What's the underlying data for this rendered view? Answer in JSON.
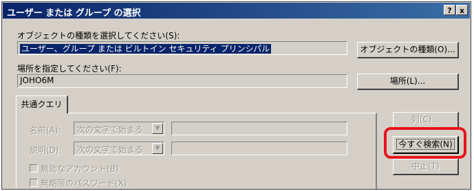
{
  "window": {
    "title": "ユーザー または グループ の選択",
    "help_btn": "?",
    "close_btn": "x"
  },
  "object_type": {
    "label": "オブジェクトの種類を選択してください(S):",
    "value": "ユーザー、グループ または ビルトイン セキュリティ プリンシパル",
    "button": "オブジェクトの種類(O)..."
  },
  "location": {
    "label": "場所を指定してください(F):",
    "value": "JOHO6M",
    "button": "場所(L)..."
  },
  "tab": {
    "label": "共通クエリ"
  },
  "query": {
    "name_label": "名前(A):",
    "name_mode": "次の文字で始まる",
    "desc_label": "説明(D):",
    "desc_mode": "次の文字で始まる",
    "disabled_accounts": "無効なアカウント(B)",
    "no_expire_password": "無期限のパスワード(X)"
  },
  "buttons": {
    "columns": "列(C)...",
    "search_now": "今すぐ検索(N)",
    "stop": "中止(T)"
  },
  "colors": {
    "highlight": "#e8141a",
    "titlebar": "#0a246a",
    "face": "#d4d0c8"
  }
}
